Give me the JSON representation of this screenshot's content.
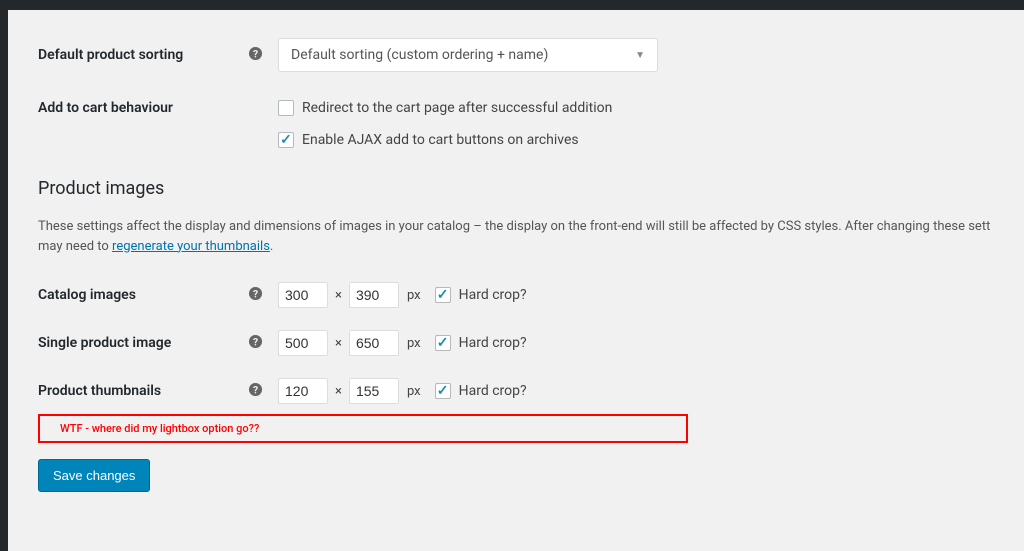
{
  "fields": {
    "default_sorting": {
      "label": "Default product sorting",
      "value": "Default sorting (custom ordering + name)"
    },
    "add_to_cart": {
      "label": "Add to cart behaviour",
      "redirect_label": "Redirect to the cart page after successful addition",
      "ajax_label": "Enable AJAX add to cart buttons on archives"
    },
    "product_images": {
      "heading": "Product images",
      "desc_part1": "These settings affect the display and dimensions of images in your catalog – the display on the front-end will still be affected by CSS styles. After changing these sett",
      "desc_part2": "may need to ",
      "link": "regenerate your thumbnails",
      "desc_part3": "."
    },
    "catalog_images": {
      "label": "Catalog images",
      "w": "300",
      "h": "390",
      "px": "px",
      "times": "×",
      "hard_crop": "Hard crop?"
    },
    "single_product": {
      "label": "Single product image",
      "w": "500",
      "h": "650",
      "px": "px",
      "times": "×",
      "hard_crop": "Hard crop?"
    },
    "thumbnails": {
      "label": "Product thumbnails",
      "w": "120",
      "h": "155",
      "px": "px",
      "times": "×",
      "hard_crop": "Hard crop?"
    },
    "annotation": "WTF - where did my lightbox option go??",
    "save_button": "Save changes"
  }
}
